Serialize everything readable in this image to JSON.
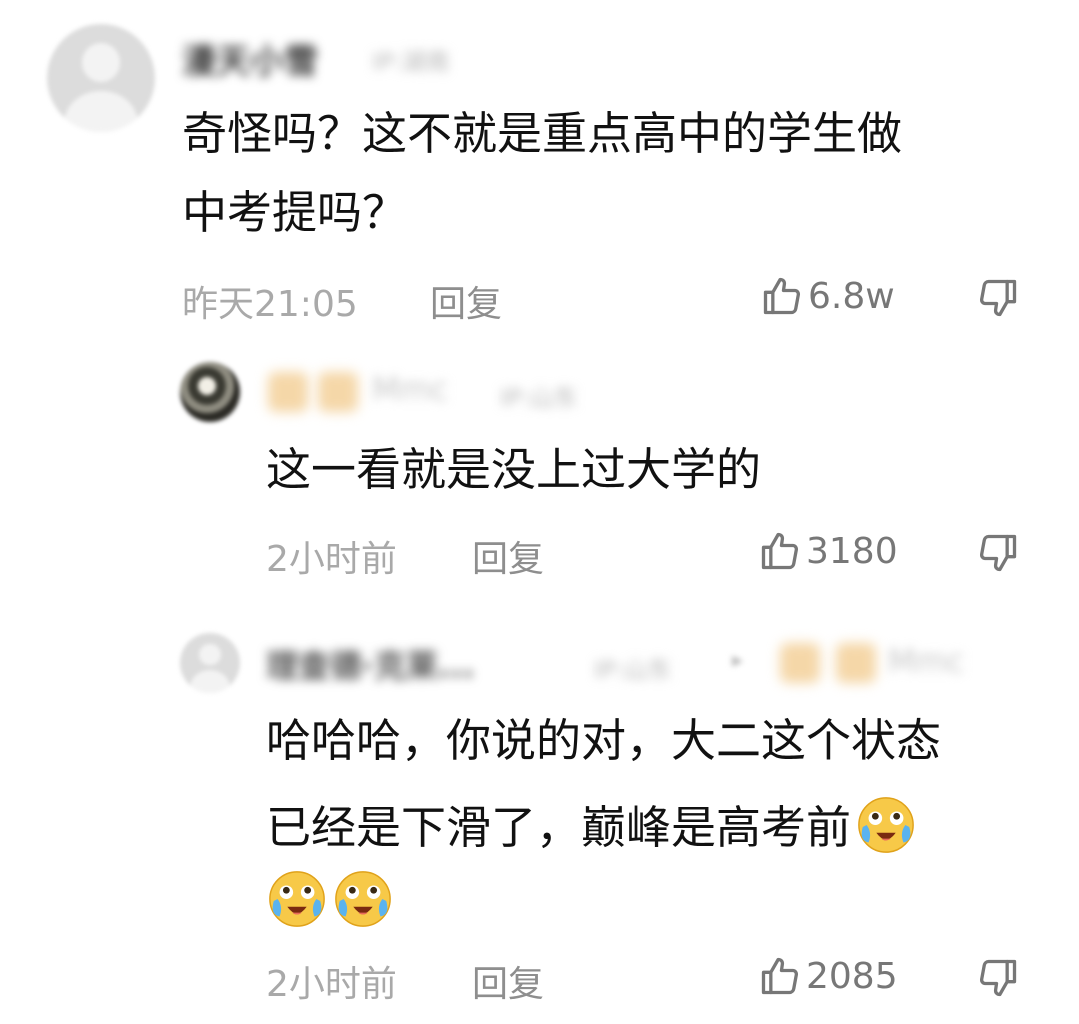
{
  "comments": [
    {
      "author": "漫天小雪",
      "location": "IP:湖南",
      "content_lines": [
        "奇怪吗？这不就是重点高中的学生做",
        "中考提吗？"
      ],
      "time": "昨天21:05",
      "reply_label": "回复",
      "likes": "6.8w"
    },
    {
      "author": "Mmc",
      "location": "IP:山东",
      "content_lines": [
        "这一看就是没上过大学的"
      ],
      "time": "2小时前",
      "reply_label": "回复",
      "likes": "3180"
    },
    {
      "author": "理查德·克莱...",
      "location": "IP:山东",
      "reply_to": "Mmc",
      "content_lines": [
        "哈哈哈，你说的对，大二这个状态",
        "已经是下滑了，巅峰是高考前"
      ],
      "time": "2小时前",
      "reply_label": "回复",
      "likes": "2085"
    }
  ],
  "icons": {
    "like": "thumbs-up-icon",
    "dislike": "thumbs-down-icon",
    "emoji": "crying-laughing-emoji"
  },
  "colors": {
    "text": "#111111",
    "meta": "#a9a9a9",
    "icon": "#777777"
  }
}
